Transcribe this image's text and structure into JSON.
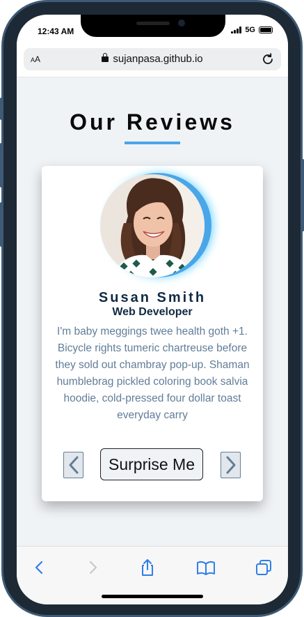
{
  "status": {
    "time": "12:43 AM",
    "network": "5G"
  },
  "browser": {
    "text_size_label_small": "A",
    "text_size_label_large": "A",
    "url": "sujanpasa.github.io"
  },
  "page": {
    "title": "Our Reviews"
  },
  "review": {
    "name": "Susan Smith",
    "job": "Web Developer",
    "text": "I'm baby meggings twee health goth +1. Bicycle rights tumeric chartreuse before they sold out chambray pop-up. Shaman humblebrag pickled coloring book salvia hoodie, cold-pressed four dollar toast everyday carry"
  },
  "controls": {
    "random_label": "Surprise Me"
  },
  "colors": {
    "accent": "#49a6e9",
    "name": "#102a43",
    "body_text": "#617d98",
    "background": "#f0f3f6"
  },
  "toolbar": {
    "icons": [
      "back-icon",
      "forward-icon",
      "share-icon",
      "bookmarks-icon",
      "tabs-icon"
    ]
  }
}
